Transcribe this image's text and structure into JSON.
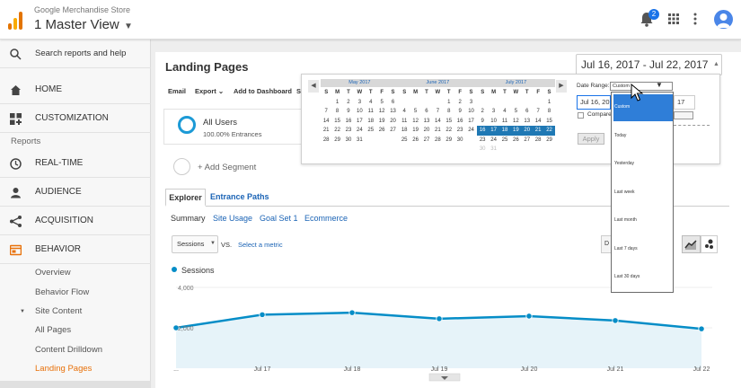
{
  "header": {
    "account": "Google Merchandise Store",
    "view": "1 Master View",
    "notification_count": "2"
  },
  "sidebar": {
    "search": "Search reports and help",
    "home": "HOME",
    "customization": "CUSTOMIZATION",
    "reports_label": "Reports",
    "realtime": "REAL-TIME",
    "audience": "AUDIENCE",
    "acquisition": "ACQUISITION",
    "behavior": "BEHAVIOR",
    "sub": {
      "overview": "Overview",
      "behavior_flow": "Behavior Flow",
      "site_content": "Site Content",
      "all_pages": "All Pages",
      "content_drilldown": "Content Drilldown",
      "landing_pages": "Landing Pages"
    }
  },
  "page": {
    "title": "Landing Pages",
    "toolbar": {
      "email": "Email",
      "export": "Export",
      "add_dashboard": "Add to Dashboard",
      "shortcut_initial": "S"
    },
    "segment": {
      "name": "All Users",
      "pct": "100.00% Entrances",
      "add": "+ Add Segment"
    },
    "tabs": {
      "explorer": "Explorer",
      "entrance_paths": "Entrance Paths"
    },
    "subtabs": [
      "Summary",
      "Site Usage",
      "Goal Set 1",
      "Ecommerce"
    ],
    "metric": "Sessions",
    "vs": "VS.",
    "select_metric": "Select a metric",
    "day_button": "D",
    "legend": "Sessions"
  },
  "date_picker": {
    "range_label": "Jul 16, 2017 - Jul 22, 2017",
    "date_range_field_label": "Date Range:",
    "selected_option": "Custom",
    "start_date": "Jul 16, 20",
    "end_date": "17",
    "compare_label": "Compare",
    "apply": "Apply",
    "dow": [
      "S",
      "M",
      "T",
      "W",
      "T",
      "F",
      "S"
    ],
    "months": [
      {
        "name": "May 2017",
        "rows": [
          [
            "",
            "1",
            "2",
            "3",
            "4",
            "5",
            "6"
          ],
          [
            "7",
            "8",
            "9",
            "10",
            "11",
            "12",
            "13"
          ],
          [
            "14",
            "15",
            "16",
            "17",
            "18",
            "19",
            "20"
          ],
          [
            "21",
            "22",
            "23",
            "24",
            "25",
            "26",
            "27"
          ],
          [
            "28",
            "29",
            "30",
            "31",
            "",
            "",
            ""
          ]
        ]
      },
      {
        "name": "June 2017",
        "rows": [
          [
            "",
            "",
            "",
            "",
            "1",
            "2",
            "3"
          ],
          [
            "4",
            "5",
            "6",
            "7",
            "8",
            "9",
            "10"
          ],
          [
            "11",
            "12",
            "13",
            "14",
            "15",
            "16",
            "17"
          ],
          [
            "18",
            "19",
            "20",
            "21",
            "22",
            "23",
            "24"
          ],
          [
            "25",
            "26",
            "27",
            "28",
            "29",
            "30",
            ""
          ]
        ]
      },
      {
        "name": "July 2017",
        "rows": [
          [
            "",
            "",
            "",
            "",
            "",
            "",
            "1"
          ],
          [
            "2",
            "3",
            "4",
            "5",
            "6",
            "7",
            "8"
          ],
          [
            "9",
            "10",
            "11",
            "12",
            "13",
            "14",
            "15"
          ],
          [
            "16",
            "17",
            "18",
            "19",
            "20",
            "21",
            "22"
          ],
          [
            "23",
            "24",
            "25",
            "26",
            "27",
            "28",
            "29"
          ],
          [
            "30",
            "31",
            "",
            "",
            "",
            "",
            ""
          ]
        ]
      }
    ],
    "selected_days_july": [
      "16",
      "17",
      "18",
      "19",
      "20",
      "21",
      "22"
    ],
    "options": [
      "Custom",
      "Today",
      "Yesterday",
      "Last week",
      "Last month",
      "Last 7 days",
      "Last 30 days"
    ]
  },
  "chart_data": {
    "type": "line",
    "categories": [
      "...",
      "Jul 17",
      "Jul 18",
      "Jul 19",
      "Jul 20",
      "Jul 21",
      "Jul 22"
    ],
    "series": [
      {
        "name": "Sessions",
        "values": [
          2000,
          2650,
          2750,
          2450,
          2580,
          2360,
          1950
        ]
      }
    ],
    "y_tick_labels": [
      "4,000",
      "2,000"
    ],
    "ylim": [
      0,
      4000
    ],
    "color": "#058dc7",
    "fill": "#e6f3f9"
  }
}
